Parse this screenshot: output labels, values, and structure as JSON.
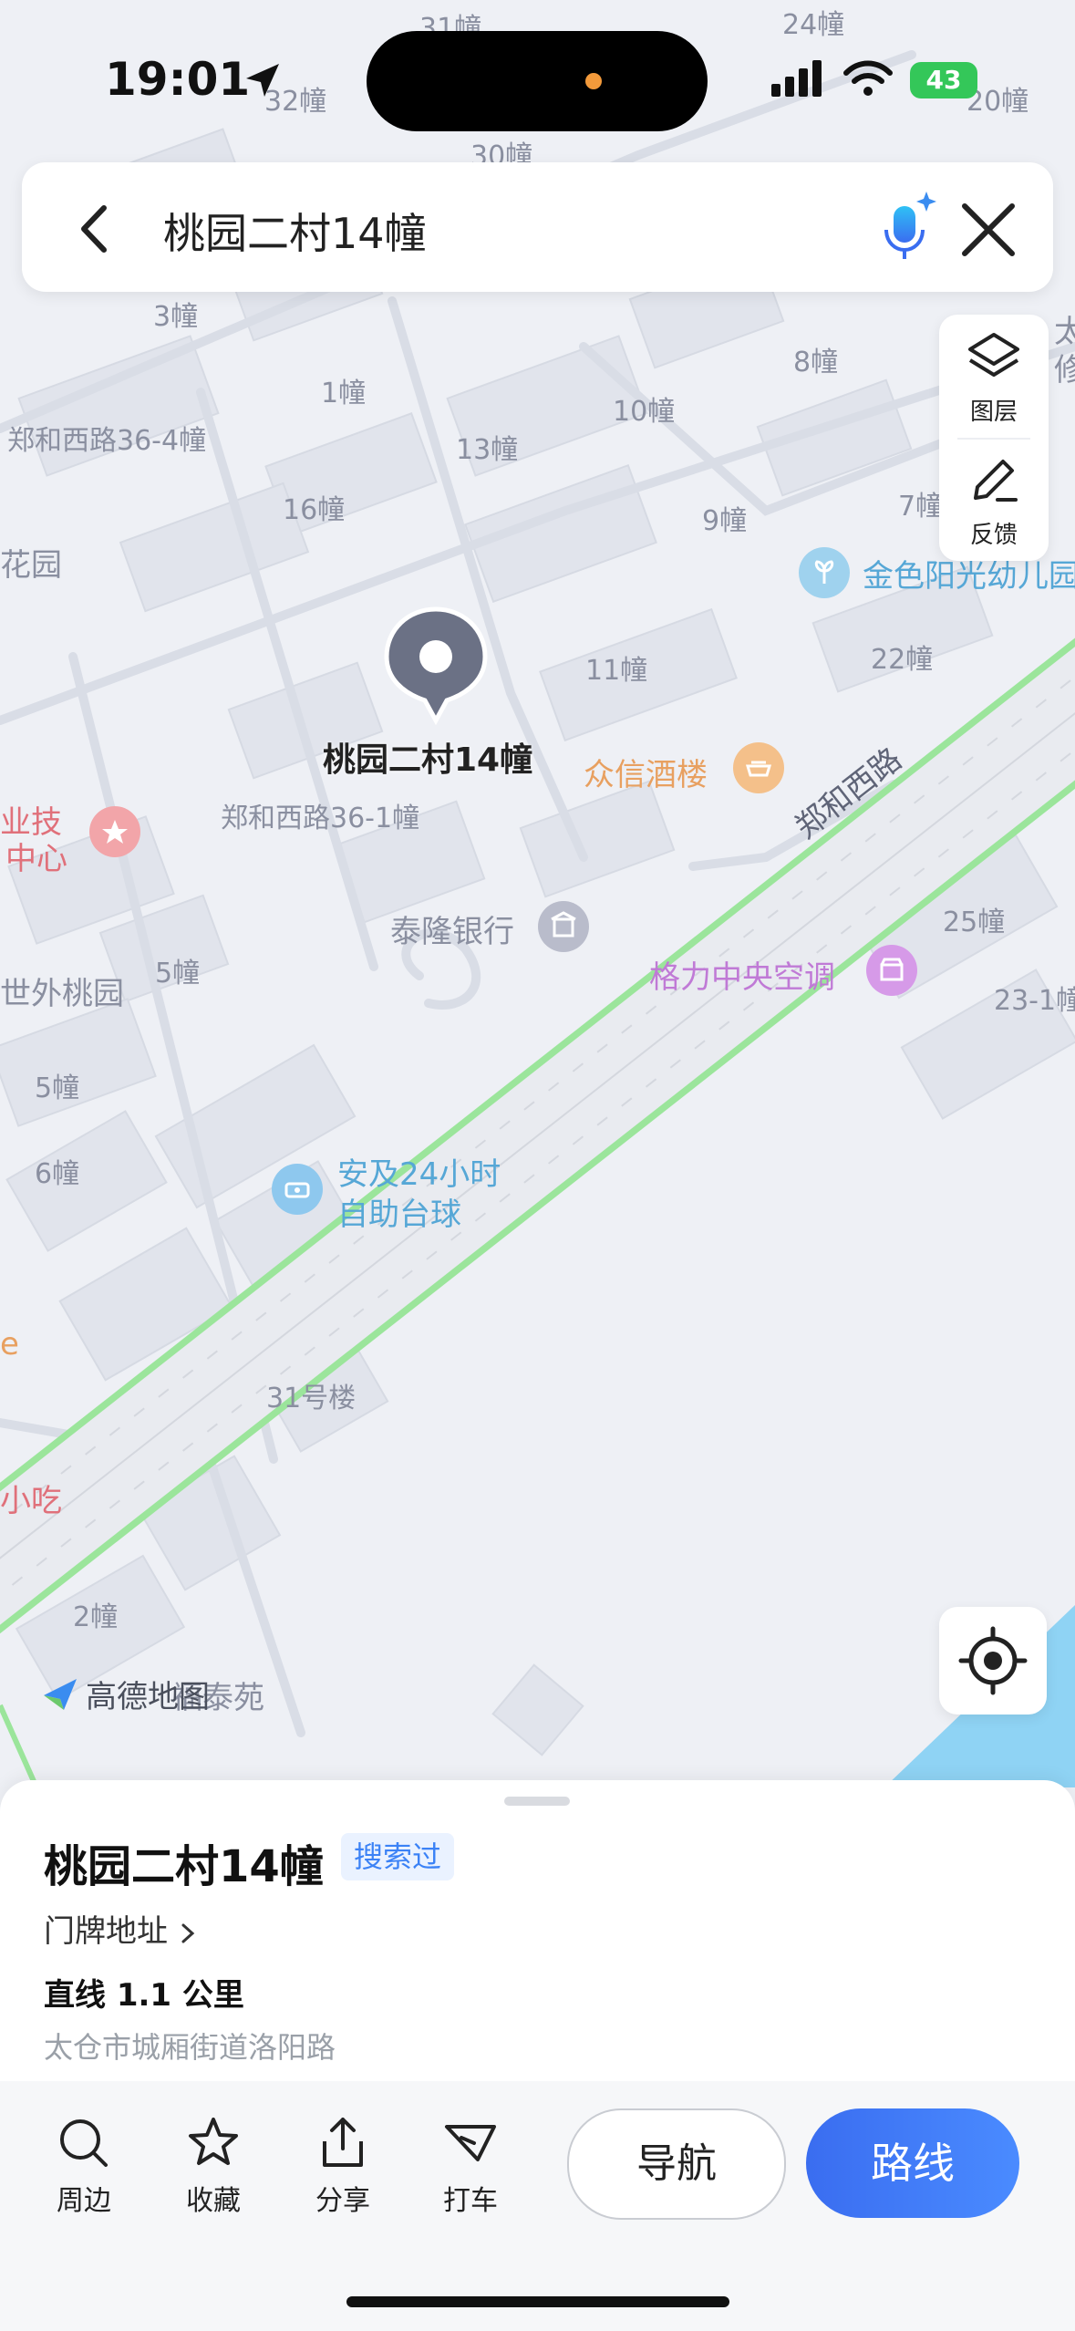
{
  "status_bar": {
    "time": "19:01",
    "battery": "43"
  },
  "search": {
    "query": "桃园二村14幢"
  },
  "side_controls": {
    "layers_label": "图层",
    "feedback_label": "反馈"
  },
  "map": {
    "building_labels": [
      "31幢",
      "24幢",
      "32幢",
      "20幢",
      "30幢",
      "3幢",
      "8幢",
      "1幢",
      "10幢",
      "郑和西路36-4幢",
      "13幢",
      "16幢",
      "9幢",
      "7幢",
      "11幢",
      "22幢",
      "郑和西路36-1幢",
      "5幢",
      "25幢",
      "23-1幢",
      "5幢",
      "6幢",
      "31号楼",
      "2幢"
    ],
    "partial_labels": [
      "太",
      "修",
      "花园",
      "业技",
      "中心",
      "世外桃园",
      "e",
      "小吃",
      "福泰苑"
    ],
    "selected_pin_label": "桃园二村14幢",
    "road_name": "郑和西路",
    "pois": {
      "kindergarten": "金色阳光幼儿园",
      "restaurant": "众信酒楼",
      "bank": "泰隆银行",
      "store": "格力中央空调",
      "billiards_line1": "安及24小时",
      "billiards_line2": "自助台球"
    },
    "logo_text": "高德地图"
  },
  "sheet": {
    "title": "桃园二村14幢",
    "badge": "搜索过",
    "address_link": "门牌地址",
    "distance": "直线 1.1 公里",
    "address": "太仓市城厢街道洛阳路"
  },
  "toolbar": {
    "nearby": "周边",
    "favorite": "收藏",
    "share": "分享",
    "taxi": "打车",
    "navigate": "导航",
    "route": "路线"
  },
  "colors": {
    "accent": "#3a6df0",
    "pin": "#6b7185",
    "road_green": "#9be59b",
    "water": "#8fd3f4"
  }
}
